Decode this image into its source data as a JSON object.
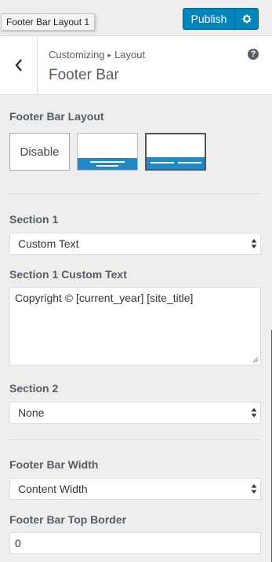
{
  "tooltip": "Footer Bar Layout 1",
  "header": {
    "publish_label": "Publish"
  },
  "panel": {
    "breadcrumb_root": "Customizing",
    "breadcrumb_sep": "▸",
    "breadcrumb_section": "Layout",
    "title": "Footer Bar",
    "help": "?"
  },
  "footer_bar_layout": {
    "label": "Footer Bar Layout",
    "options": [
      {
        "label": "Disable"
      },
      {
        "label": ""
      },
      {
        "label": ""
      }
    ],
    "selected_index": 2
  },
  "section1": {
    "label": "Section 1",
    "value": "Custom Text"
  },
  "section1_text": {
    "label": "Section 1 Custom Text",
    "value": "Copyright © [current_year] [site_title]"
  },
  "section2": {
    "label": "Section 2",
    "value": "None"
  },
  "width": {
    "label": "Footer Bar Width",
    "value": "Content Width"
  },
  "top_border": {
    "label": "Footer Bar Top Border",
    "value": "0"
  },
  "colors": {
    "accent": "#0085ba",
    "layout_bar": "#2289c4"
  }
}
